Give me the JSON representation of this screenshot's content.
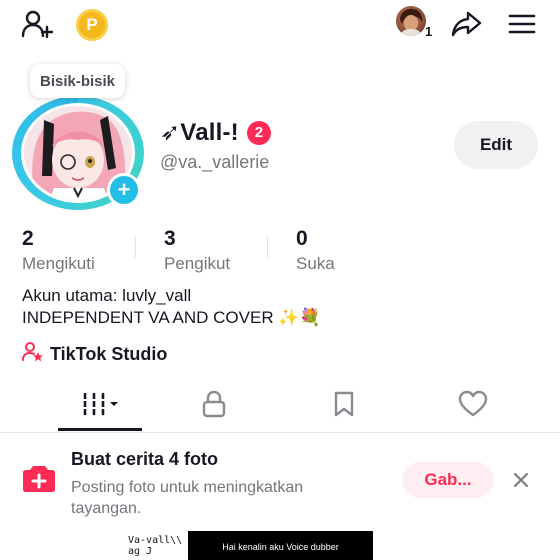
{
  "topbar": {
    "coin_symbol": "P",
    "story_count": "1"
  },
  "profile": {
    "note_tooltip": "Bisik-bisik",
    "display_name": "➶Vall-!",
    "badge_count": "2",
    "username": "@va._vallerie",
    "edit_label": "Edit"
  },
  "stats": [
    {
      "value": "2",
      "label": "Mengikuti"
    },
    {
      "value": "3",
      "label": "Pengikut"
    },
    {
      "value": "0",
      "label": "Suka"
    }
  ],
  "bio": {
    "line1": "Akun utama: luvly_vall",
    "line2": "INDEPENDENT VA AND COVER ✨💐"
  },
  "studio": {
    "label": "TikTok Studio"
  },
  "tabs": [
    {
      "icon": "videos-grid-icon",
      "active": true
    },
    {
      "icon": "lock-icon",
      "active": false
    },
    {
      "icon": "bookmark-icon",
      "active": false
    },
    {
      "icon": "heart-icon",
      "active": false
    }
  ],
  "banner": {
    "title": "Buat cerita 4 foto",
    "description": "Posting foto untuk meningkatkan tayangan.",
    "join_label": "Gab..."
  },
  "videos": {
    "thumb1_text": "Va-vall\\\\ ag J",
    "thumb2_text": "Hai kenalin aku Voice dubber"
  },
  "colors": {
    "accent": "#fe2c55",
    "ring": "#38c7e8",
    "coin": "#f5b81d",
    "muted_text": "#75767d"
  }
}
